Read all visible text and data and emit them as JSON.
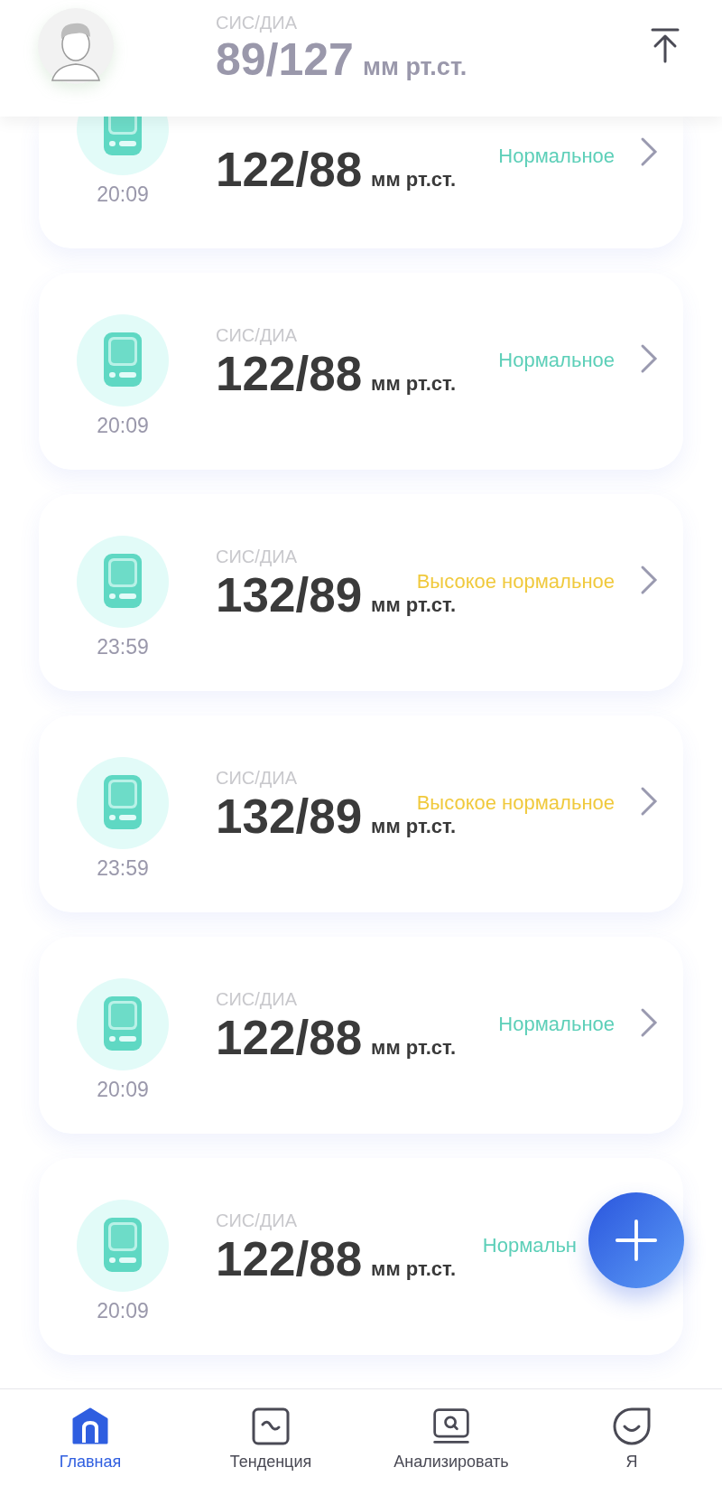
{
  "header": {
    "label": "СИС/ДИА",
    "value": "89/127",
    "unit": "мм рт.ст."
  },
  "records": [
    {
      "cut_top": true,
      "value": "122/88",
      "unit": "мм рт.ст.",
      "time": "20:09",
      "status": "Нормальное",
      "color": "#5ccfb8",
      "chevron": true
    },
    {
      "cut_top": false,
      "label": "СИС/ДИА",
      "value": "122/88",
      "unit": "мм рт.ст.",
      "time": "20:09",
      "status": "Нормальное",
      "color": "#5ccfb8",
      "chevron": true
    },
    {
      "cut_top": false,
      "label": "СИС/ДИА",
      "value": "132/89",
      "unit": "мм рт.ст.",
      "time": "23:59",
      "status": "Высокое нормальное",
      "color": "#f0c93c",
      "chevron": true
    },
    {
      "cut_top": false,
      "label": "СИС/ДИА",
      "value": "132/89",
      "unit": "мм рт.ст.",
      "time": "23:59",
      "status": "Высокое нормальное",
      "color": "#f0c93c",
      "chevron": true
    },
    {
      "cut_top": false,
      "label": "СИС/ДИА",
      "value": "122/88",
      "unit": "мм рт.ст.",
      "time": "20:09",
      "status": "Нормальное",
      "color": "#5ccfb8",
      "chevron": true
    },
    {
      "cut_top": false,
      "label": "СИС/ДИА",
      "value": "122/88",
      "unit": "мм рт.ст.",
      "time": "20:09",
      "status": "Нормальн",
      "color": "#5ccfb8",
      "chevron": false
    }
  ],
  "nav": [
    {
      "kind": "home",
      "label": "Главная",
      "selected": true
    },
    {
      "kind": "trend",
      "label": "Тенденция",
      "selected": false
    },
    {
      "kind": "analyze",
      "label": "Анализировать",
      "selected": false
    },
    {
      "kind": "me",
      "label": "Я",
      "selected": false
    }
  ]
}
